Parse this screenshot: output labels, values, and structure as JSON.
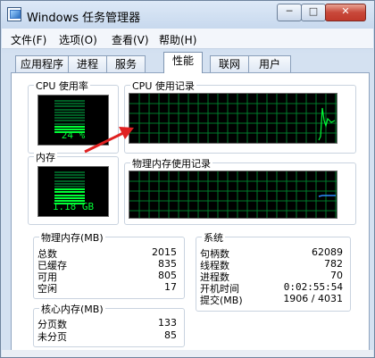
{
  "window": {
    "title": "Windows 任务管理器"
  },
  "title_buttons": {
    "min": "─",
    "max": "□",
    "close": "✕"
  },
  "menu": [
    "文件(F)",
    "选项(O)",
    "查看(V)",
    "帮助(H)"
  ],
  "tabs": [
    "应用程序",
    "进程",
    "服务",
    "性能",
    "联网",
    "用户"
  ],
  "active_tab": "性能",
  "cpu_usage": {
    "title": "CPU 使用率",
    "value_label": "24 %",
    "level": 0.24
  },
  "cpu_history": {
    "title": "CPU 使用记录"
  },
  "memory": {
    "title": "内存",
    "value_label": "1.18 GB",
    "level": 0.47
  },
  "memory_history": {
    "title": "物理内存使用记录"
  },
  "physical_memory": {
    "title": "物理内存(MB)",
    "rows": [
      {
        "label": "总数",
        "value": "2015"
      },
      {
        "label": "已缓存",
        "value": "835"
      },
      {
        "label": "可用",
        "value": "805"
      },
      {
        "label": "空闲",
        "value": "17"
      }
    ]
  },
  "kernel_memory": {
    "title": "核心内存(MB)",
    "rows": [
      {
        "label": "分页数",
        "value": "133"
      },
      {
        "label": "未分页",
        "value": "85"
      }
    ]
  },
  "system": {
    "title": "系统",
    "rows": [
      {
        "label": "句柄数",
        "value": "62089"
      },
      {
        "label": "线程数",
        "value": "782"
      },
      {
        "label": "进程数",
        "value": "70"
      },
      {
        "label": "开机时间",
        "value": "0:02:55:54"
      },
      {
        "label": "提交(MB)",
        "value": "1906 / 4031"
      }
    ]
  },
  "colors": {
    "grid": "#007a2a",
    "trace_cpu": "#00ff36",
    "trace_mem": "#2d8cff",
    "annotation_arrow": "#e02020"
  }
}
